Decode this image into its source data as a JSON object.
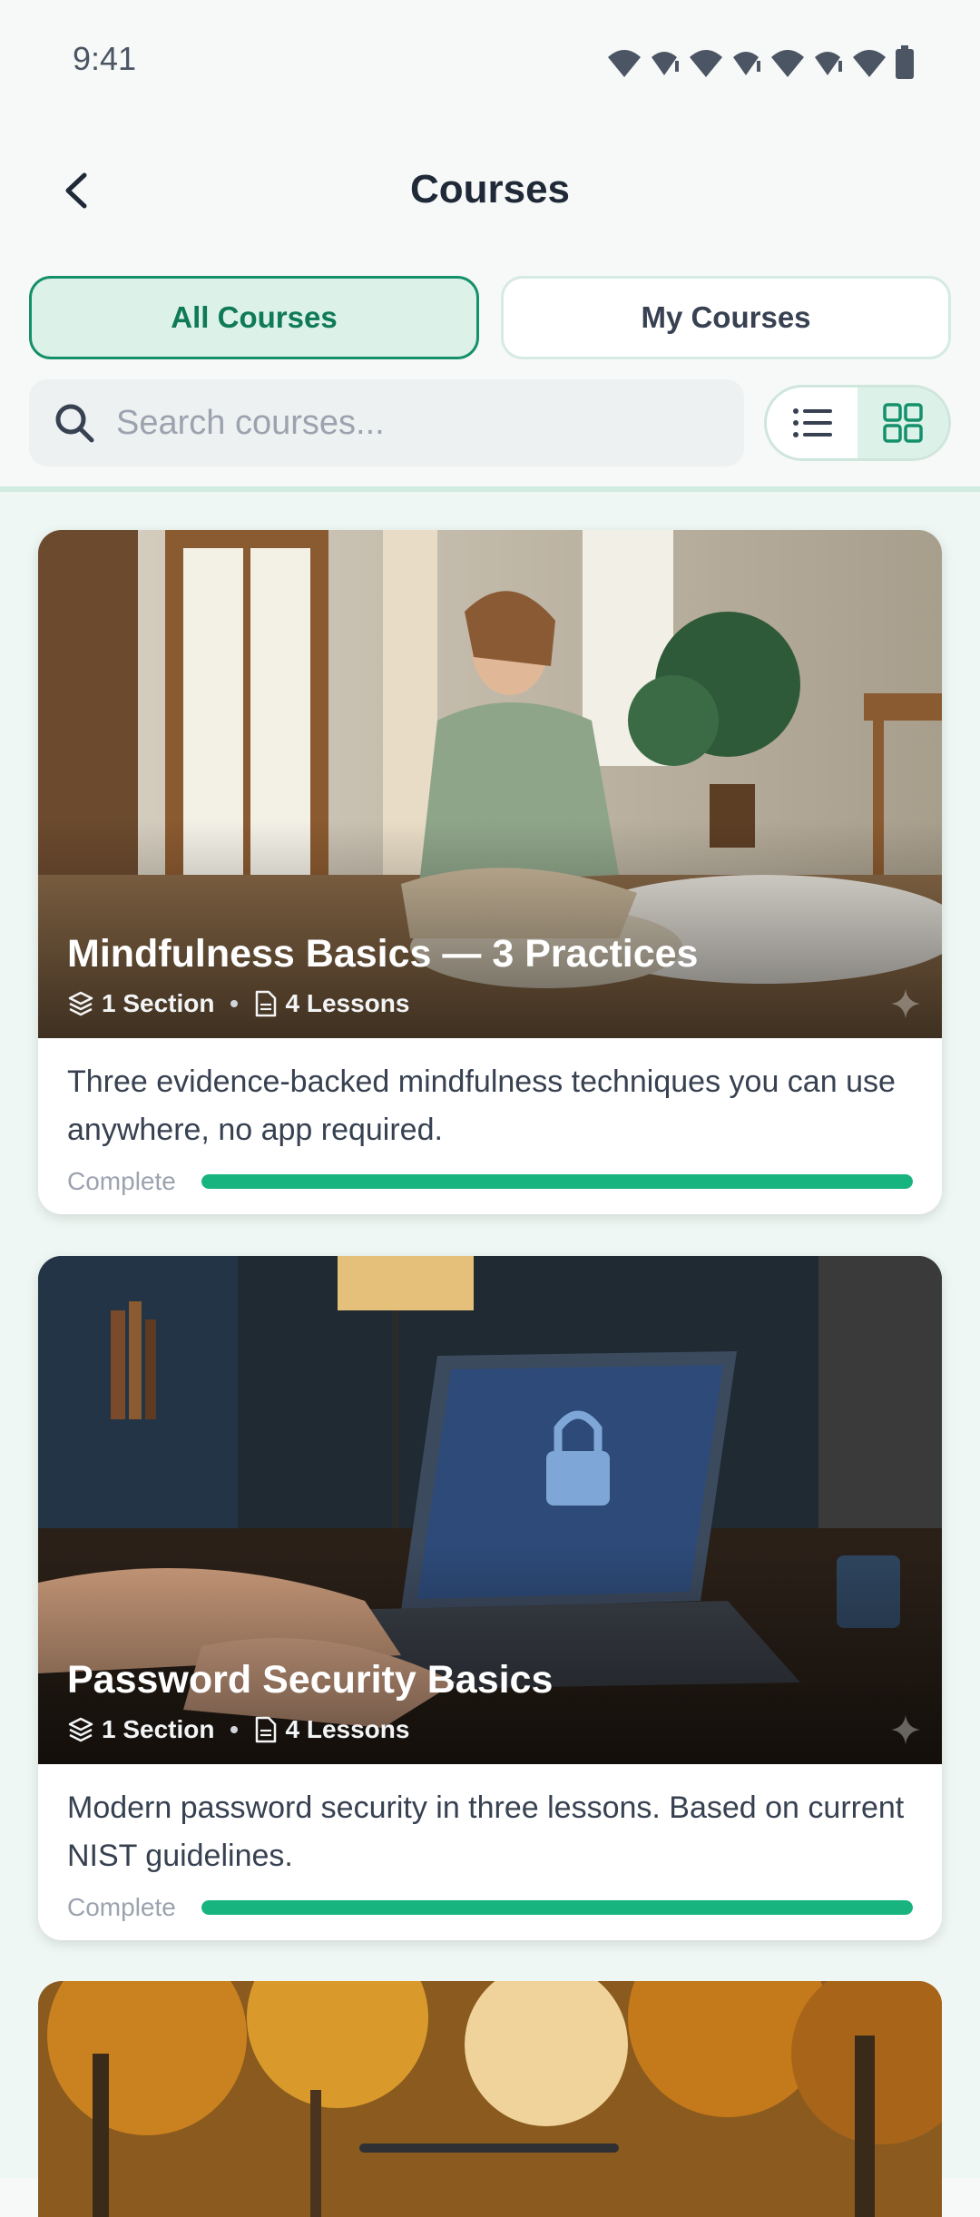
{
  "status_bar": {
    "time": "9:41"
  },
  "header": {
    "title": "Courses"
  },
  "tabs": [
    {
      "label": "All Courses",
      "active": true
    },
    {
      "label": "My Courses",
      "active": false
    }
  ],
  "search": {
    "placeholder": "Search courses..."
  },
  "view_toggle": {
    "options": [
      "list-icon",
      "grid-icon"
    ],
    "selected": "grid"
  },
  "colors": {
    "accent": "#14906a",
    "progress": "#17b47f",
    "active_tab_bg": "#dcf1e8"
  },
  "courses": [
    {
      "title": "Mindfulness Basics — 3 Practices",
      "sections": "1 Section",
      "lessons": "4 Lessons",
      "description": "Three evidence-backed mindfulness techniques you can use anywhere, no app required.",
      "progress_label": "Complete",
      "progress": 1.0
    },
    {
      "title": "Password Security Basics",
      "sections": "1 Section",
      "lessons": "4 Lessons",
      "description": "Modern password security in three lessons. Based on current NIST guidelines.",
      "progress_label": "Complete",
      "progress": 1.0
    }
  ]
}
